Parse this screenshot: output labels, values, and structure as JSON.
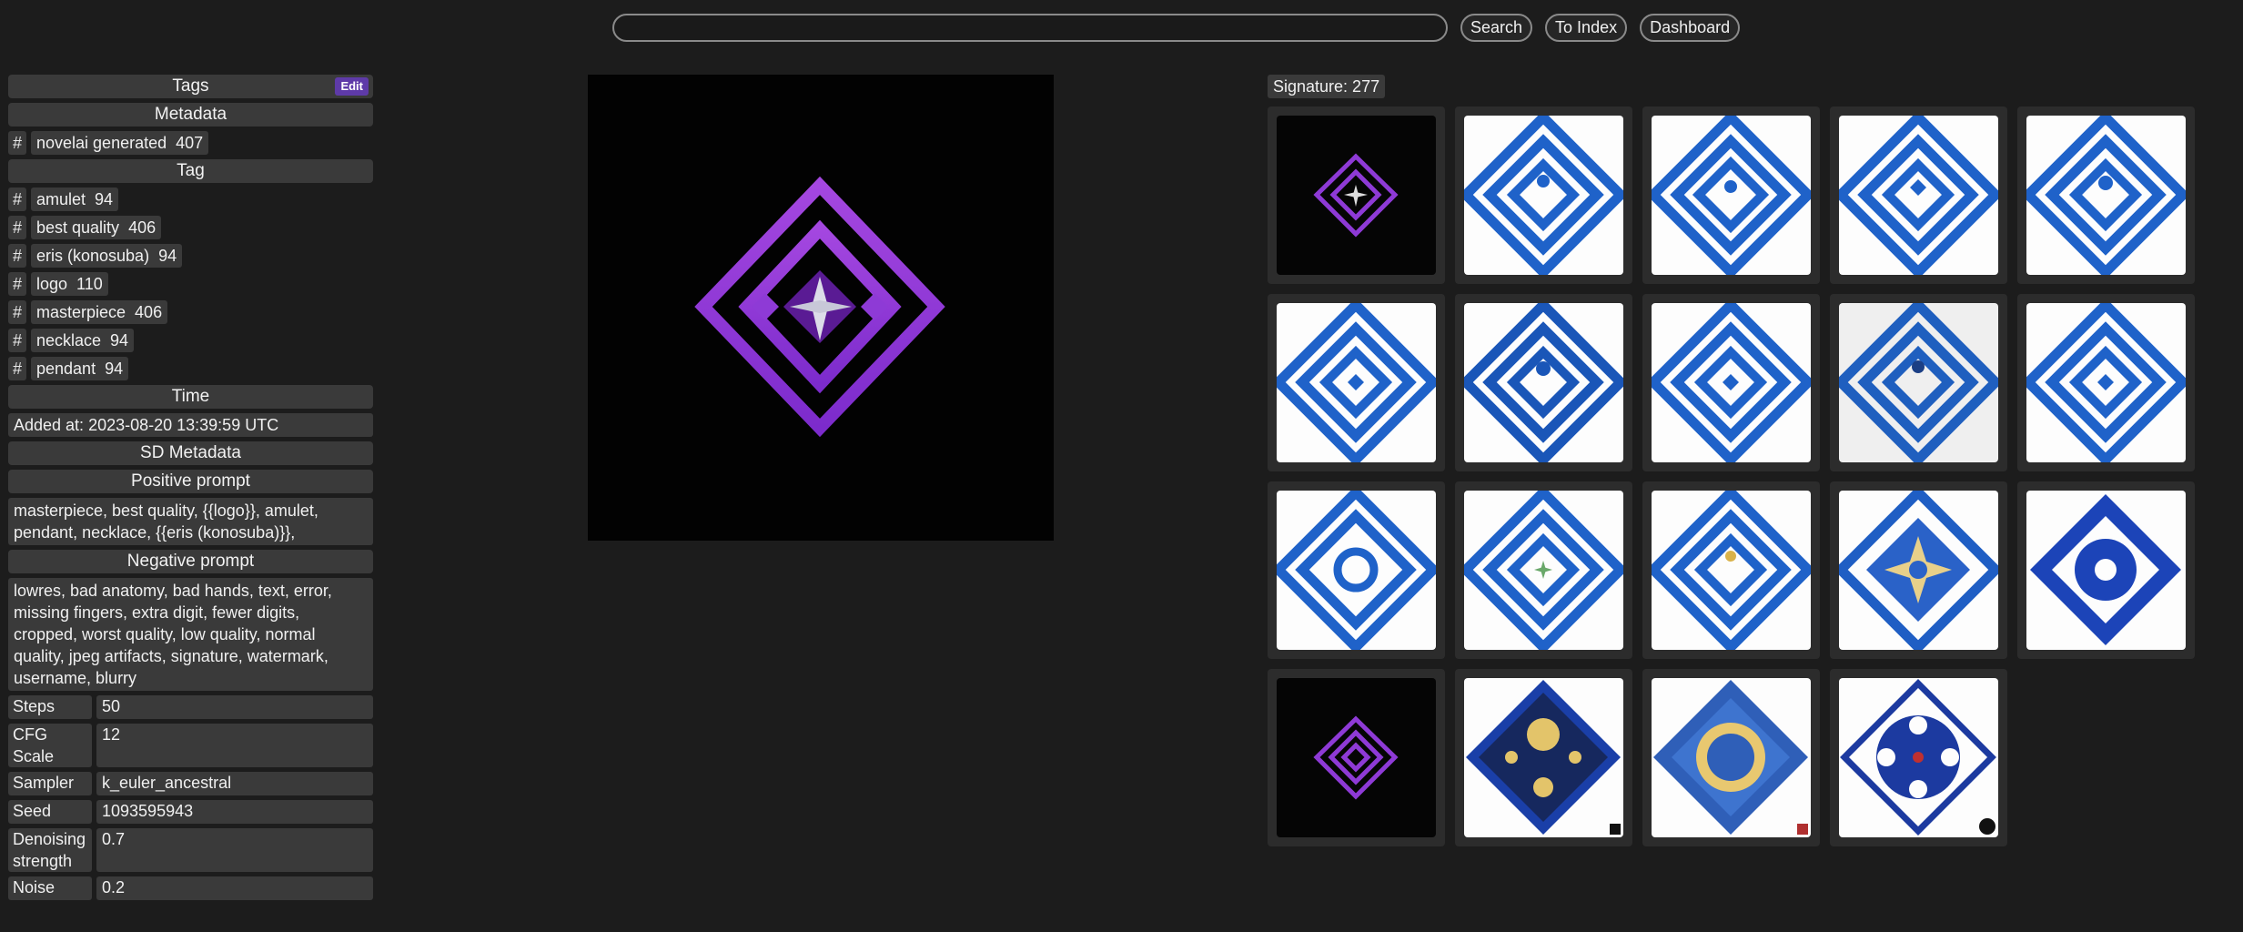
{
  "topbar": {
    "search_value": "",
    "search_label": "Search",
    "index_label": "To Index",
    "dashboard_label": "Dashboard"
  },
  "sidebar": {
    "tags_header": "Tags",
    "edit_label": "Edit",
    "metadata_header": "Metadata",
    "metadata_tags": [
      {
        "name": "novelai generated",
        "count": "407"
      }
    ],
    "tag_header": "Tag",
    "tags": [
      {
        "name": "amulet",
        "count": "94"
      },
      {
        "name": "best quality",
        "count": "406"
      },
      {
        "name": "eris (konosuba)",
        "count": "94"
      },
      {
        "name": "logo",
        "count": "110"
      },
      {
        "name": "masterpiece",
        "count": "406"
      },
      {
        "name": "necklace",
        "count": "94"
      },
      {
        "name": "pendant",
        "count": "94"
      }
    ],
    "hash_symbol": "#",
    "time_header": "Time",
    "added_at": "Added at: 2023-08-20 13:39:59 UTC",
    "sd_header": "SD Metadata",
    "positive_header": "Positive prompt",
    "positive_prompt": "masterpiece, best quality, {{logo}}, amulet, pendant, necklace, {{eris (konosuba)}},",
    "negative_header": "Negative prompt",
    "negative_prompt": "lowres, bad anatomy, bad hands, text, error, missing fingers, extra digit, fewer digits, cropped, worst quality, low quality, normal quality, jpeg artifacts, signature, watermark, username, blurry",
    "params": [
      {
        "key": "Steps",
        "value": "50"
      },
      {
        "key": "CFG Scale",
        "value": "12"
      },
      {
        "key": "Sampler",
        "value": "k_euler_ancestral"
      },
      {
        "key": "Seed",
        "value": "1093595943"
      },
      {
        "key": "Denoising strength",
        "value": "0.7"
      },
      {
        "key": "Noise",
        "value": "0.2"
      }
    ]
  },
  "similar": {
    "signature": "Signature: 277"
  },
  "colors": {
    "background": "#1c1c1c",
    "panel": "#3a3a3a",
    "accent_purple": "#8e3ad6",
    "edit_button": "#5e3aa8",
    "tile_blue": "#1f62c9",
    "tile_navy": "#1a3fa8"
  }
}
